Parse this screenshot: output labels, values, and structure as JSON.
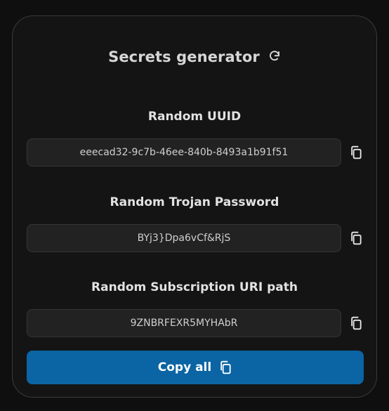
{
  "header": {
    "title": "Secrets generator",
    "refresh_icon": "refresh-icon"
  },
  "fields": [
    {
      "label": "Random UUID",
      "value": "eeecad32-9c7b-46ee-840b-8493a1b91f51",
      "copy_icon": "copy-icon"
    },
    {
      "label": "Random Trojan Password",
      "value": "BYj3}Dpa6vCf&RjS",
      "copy_icon": "copy-icon"
    },
    {
      "label": "Random Subscription URI path",
      "value": "9ZNBRFEXR5MYHAbR",
      "copy_icon": "copy-icon"
    }
  ],
  "actions": {
    "copy_all_label": "Copy all",
    "copy_all_icon": "copy-icon"
  },
  "colors": {
    "background": "#0f0f0f",
    "card": "#141414",
    "field": "#222222",
    "accent": "#0b64a3"
  }
}
